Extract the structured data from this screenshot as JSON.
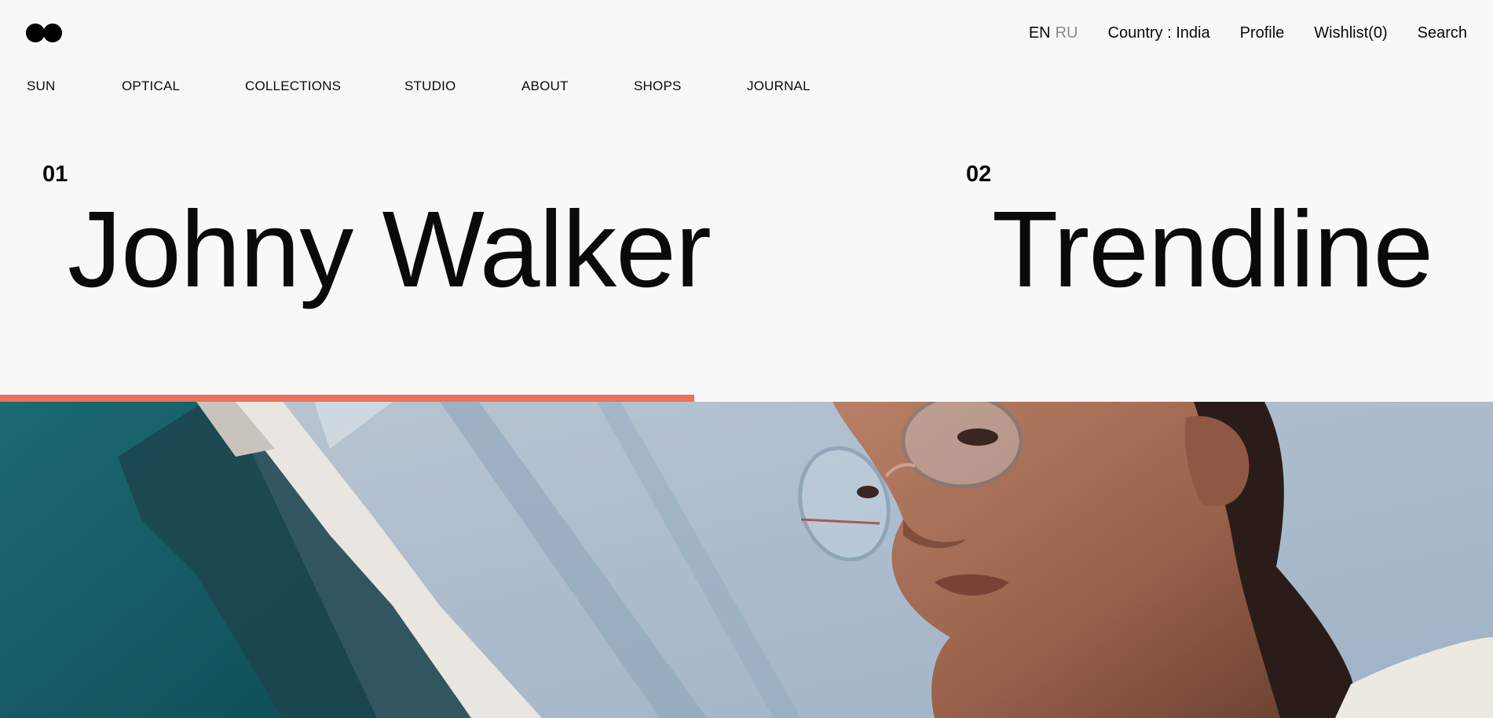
{
  "header": {
    "logo_icon": "two-dots-logo-icon",
    "languages": {
      "active": "EN",
      "inactive": "RU"
    },
    "country": "Country : India",
    "profile": "Profile",
    "wishlist": "Wishlist(0)",
    "search": "Search"
  },
  "nav": {
    "items": [
      "SUN",
      "OPTICAL",
      "COLLECTIONS",
      "STUDIO",
      "ABOUT",
      "SHOPS",
      "JOURNAL"
    ]
  },
  "hero": {
    "slides": [
      {
        "number": "01",
        "title": "Johny Walker"
      },
      {
        "number": "02",
        "title": "Trendline"
      }
    ],
    "progress": 0.465,
    "colors": {
      "progress": "#e8735a",
      "sky": "#a7b8ca",
      "teal": "#1e5f66"
    },
    "image_subject": "woman-with-glasses-photo"
  }
}
